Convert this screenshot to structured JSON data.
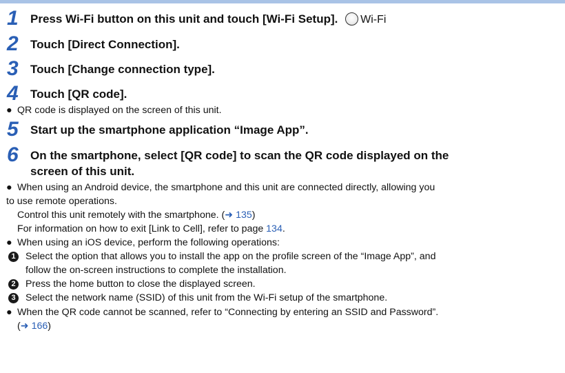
{
  "steps": [
    {
      "num": "1",
      "text": "Press Wi-Fi button on this unit and touch [Wi-Fi Setup].",
      "icon_label": "Wi-Fi"
    },
    {
      "num": "2",
      "text": "Touch [Direct Connection]."
    },
    {
      "num": "3",
      "text": "Touch [Change connection type]."
    },
    {
      "num": "4",
      "text": "Touch [QR code]."
    },
    {
      "num": "5",
      "text": "Start up the smartphone application “Image App”."
    },
    {
      "num": "6",
      "line1": "On the smartphone, select [QR code] to scan the QR code displayed on the",
      "line2": "screen of this unit."
    }
  ],
  "note_qr": "QR code is displayed on the screen of this unit.",
  "android": {
    "line1": "When using an Android device, the smartphone and this unit are connected directly, allowing you",
    "line2": "to use remote operations.",
    "control_text": "Control this unit remotely with the smartphone. (",
    "control_link": "➜ 135",
    "control_end": ")",
    "exit_text": "For information on how to exit [Link to Cell], refer to page ",
    "exit_link": "134",
    "exit_end": "."
  },
  "ios": {
    "intro": "When using an iOS device, perform the following operations:",
    "items": [
      {
        "marker": "1",
        "line1": "Select the option that allows you to install the app on the profile screen of the “Image App”, and",
        "line2": "follow the on-screen instructions to complete the installation."
      },
      {
        "marker": "2",
        "line1": "Press the home button to close the displayed screen."
      },
      {
        "marker": "3",
        "line1": "Select the network name (SSID) of this unit from the Wi-Fi setup of the smartphone."
      }
    ]
  },
  "cannot_scan": {
    "line1": "When the QR code cannot be scanned, refer to “Connecting by entering an SSID and Password”.",
    "open": "(",
    "link": "➜ 166",
    "close": ")"
  },
  "bullet_char": "●",
  "colors": {
    "step_number": "#2a5fb5",
    "link": "#2a5fb5",
    "top_bar": "#a9c3e6"
  }
}
